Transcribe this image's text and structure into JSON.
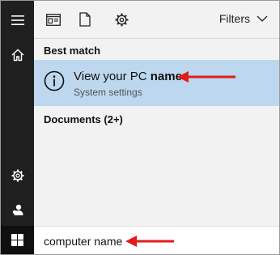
{
  "toolbar": {
    "icons": [
      "apps-icon",
      "document-icon",
      "settings-icon"
    ],
    "filters_label": "Filters"
  },
  "results": {
    "best_match_label": "Best match",
    "best_match": {
      "title_prefix": "View your PC ",
      "title_bold": "name",
      "subtitle": "System settings",
      "icon": "info-icon"
    },
    "documents_label": "Documents (2+)"
  },
  "search": {
    "query": "computer name"
  },
  "rail": {
    "icons": [
      "hamburger-icon",
      "home-icon",
      "gear-icon",
      "user-icon",
      "windows-logo-icon"
    ]
  },
  "colors": {
    "selected_row": "#bcd7ee",
    "rail_background": "#1f1f1f",
    "annotation_arrow": "#e31b1b"
  }
}
